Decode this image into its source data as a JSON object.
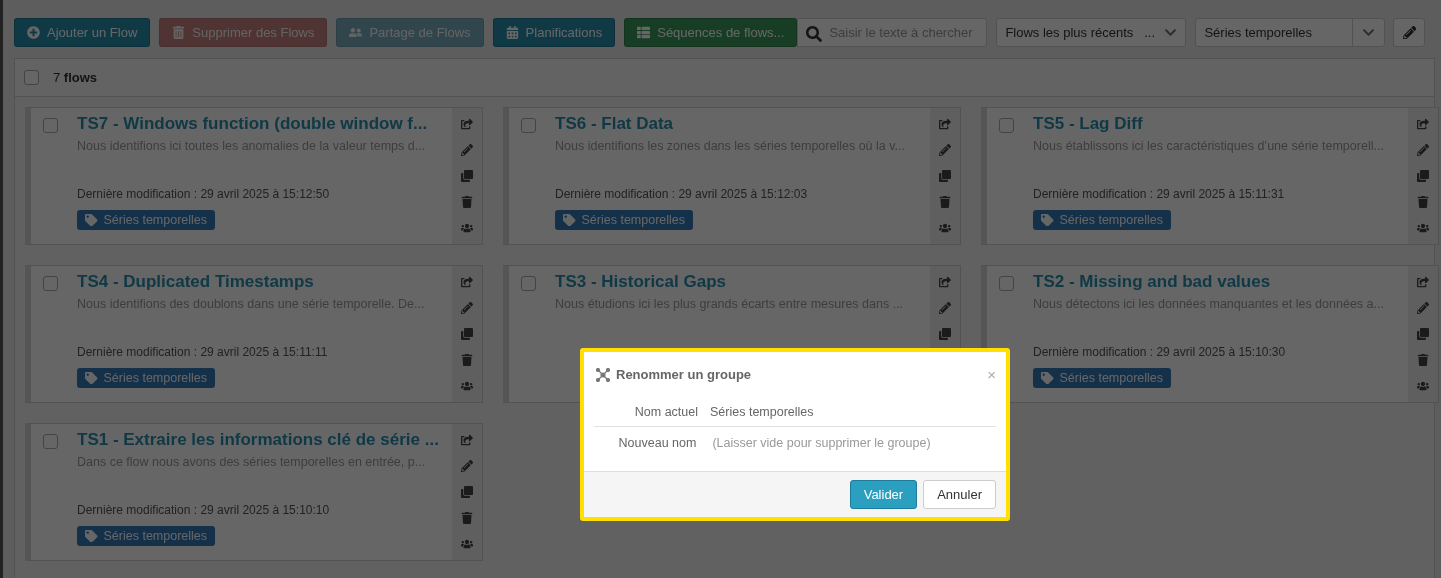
{
  "toolbar": {
    "buttons": [
      {
        "label": "Ajouter un Flow",
        "kind": "add",
        "disabled": false
      },
      {
        "label": "Supprimer des Flows",
        "kind": "delete",
        "disabled": true
      },
      {
        "label": "Partage de Flows",
        "kind": "share",
        "disabled": true
      },
      {
        "label": "Planifications",
        "kind": "schedule",
        "disabled": false
      },
      {
        "label": "Séquences de flows...",
        "kind": "sequence",
        "disabled": false
      }
    ],
    "search": {
      "placeholder": "Saisir le texte à chercher"
    },
    "sort_select": {
      "value": "Flows les plus récents",
      "more": "..."
    },
    "group_select": {
      "value": "Séries temporelles"
    }
  },
  "list_header": {
    "checked": false,
    "count": "7",
    "unit": "flows"
  },
  "flows": [
    {
      "title": "TS7 - Windows function (double window f...",
      "description": "Nous identifions ici toutes les anomalies de la valeur temps d...",
      "modified_label": "Dernière modification",
      "modified": " : 29 avril 2025 à 15:12:50",
      "tag": "Séries temporelles",
      "checked": false
    },
    {
      "title": "TS6 - Flat Data",
      "description": "Nous identifions les zones dans les séries temporelles où la v...",
      "modified_label": "Dernière modification",
      "modified": " : 29 avril 2025 à 15:12:03",
      "tag": "Séries temporelles",
      "checked": false
    },
    {
      "title": "TS5 - Lag Diff",
      "description": "Nous établissons ici les caractéristiques d’une série temporell...",
      "modified_label": "Dernière modification",
      "modified": " : 29 avril 2025 à 15:11:31",
      "tag": "Séries temporelles",
      "checked": false
    },
    {
      "title": "TS4 - Duplicated Timestamps",
      "description": "Nous identifions des doublons dans une série temporelle. De...",
      "modified_label": "Dernière modification",
      "modified": " : 29 avril 2025 à 15:11:11",
      "tag": "Séries temporelles",
      "checked": false
    },
    {
      "title": "TS3 - Historical Gaps",
      "description": "Nous étudions ici les plus grands écarts entre mesures dans ...",
      "checked": false
    },
    {
      "title": "TS2 - Missing and bad values",
      "description": "Nous détectons ici les données manquantes et les données a...",
      "modified_label": "Dernière modification",
      "modified": " : 29 avril 2025 à 15:10:30",
      "tag": "Séries temporelles",
      "checked": false
    },
    {
      "title": "TS1 - Extraire les informations clé de série ...",
      "description": "Dans ce flow nous avons des séries temporelles en entrée, p...",
      "modified_label": "Dernière modification",
      "modified": " : 29 avril 2025 à 15:10:10",
      "tag": "Séries temporelles",
      "checked": false
    }
  ],
  "dialog": {
    "title": "Renommer un groupe",
    "close": "×",
    "fields": [
      {
        "label": "Nom actuel",
        "kind": "text",
        "value": "Séries temporelles"
      },
      {
        "label": "Nouveau nom",
        "kind": "input",
        "placeholder": "(Laisser vide pour supprimer le groupe)"
      }
    ],
    "buttons": [
      {
        "label": "Valider",
        "kind": "primary"
      },
      {
        "label": "Annuler",
        "kind": "default"
      }
    ]
  }
}
